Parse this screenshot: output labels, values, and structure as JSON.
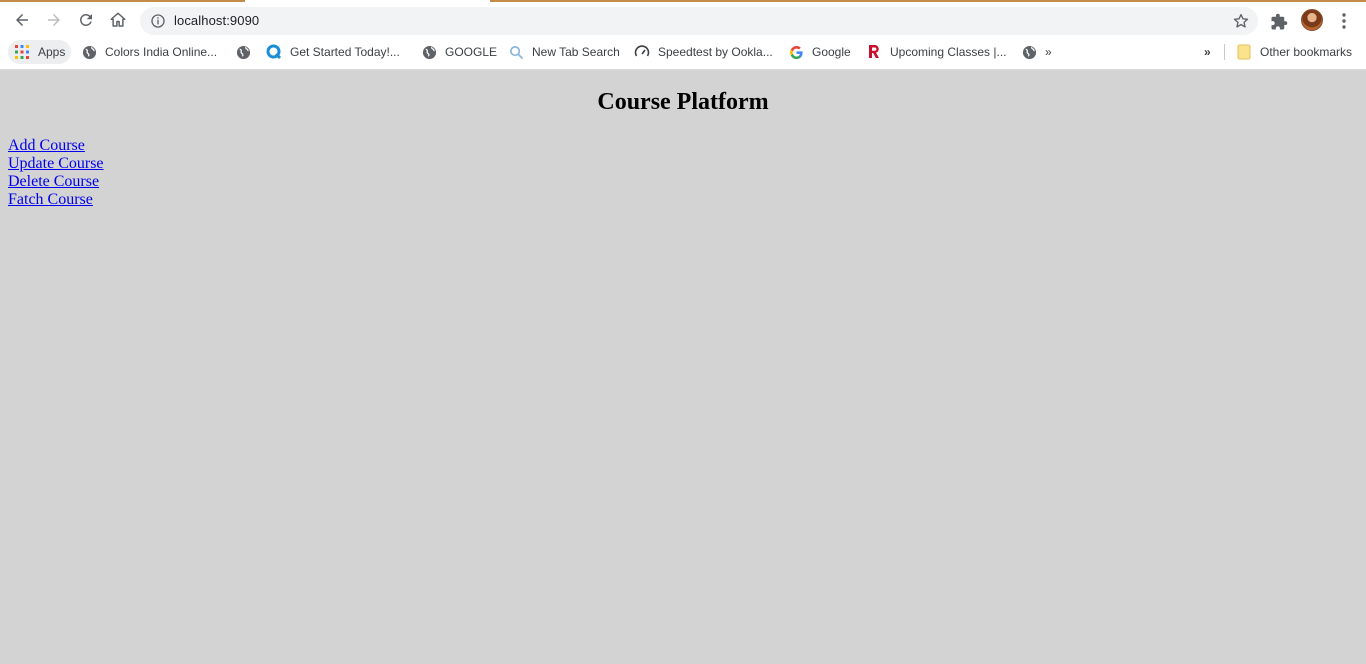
{
  "browser": {
    "url": "localhost:9090",
    "bookmarks": [
      {
        "label": "Apps",
        "icon": "apps-grid-icon"
      },
      {
        "label": "Colors India Online...",
        "icon": "globe-icon"
      },
      {
        "label": "",
        "icon": "globe-icon"
      },
      {
        "label": "Get Started Today!...",
        "icon": "q-logo-icon"
      },
      {
        "label": "GOOGLE",
        "icon": "globe-icon"
      },
      {
        "label": "New Tab Search",
        "icon": "search-icon"
      },
      {
        "label": "Speedtest by Ookla...",
        "icon": "speedometer-icon"
      },
      {
        "label": "Google",
        "icon": "google-g-icon"
      },
      {
        "label": "Upcoming Classes |...",
        "icon": "r-logo-icon"
      },
      {
        "label": "»",
        "icon": "globe-icon"
      }
    ],
    "overflow_label": "»",
    "other_bookmarks": "Other bookmarks"
  },
  "page": {
    "title": "Course Platform",
    "links": [
      "Add Course",
      "Update Course",
      "Delete Course",
      "Fatch Course"
    ]
  },
  "colors": {
    "page_background": "#d3d3d3",
    "link": "#0000ee",
    "loading_bar": "#c58b4a"
  }
}
